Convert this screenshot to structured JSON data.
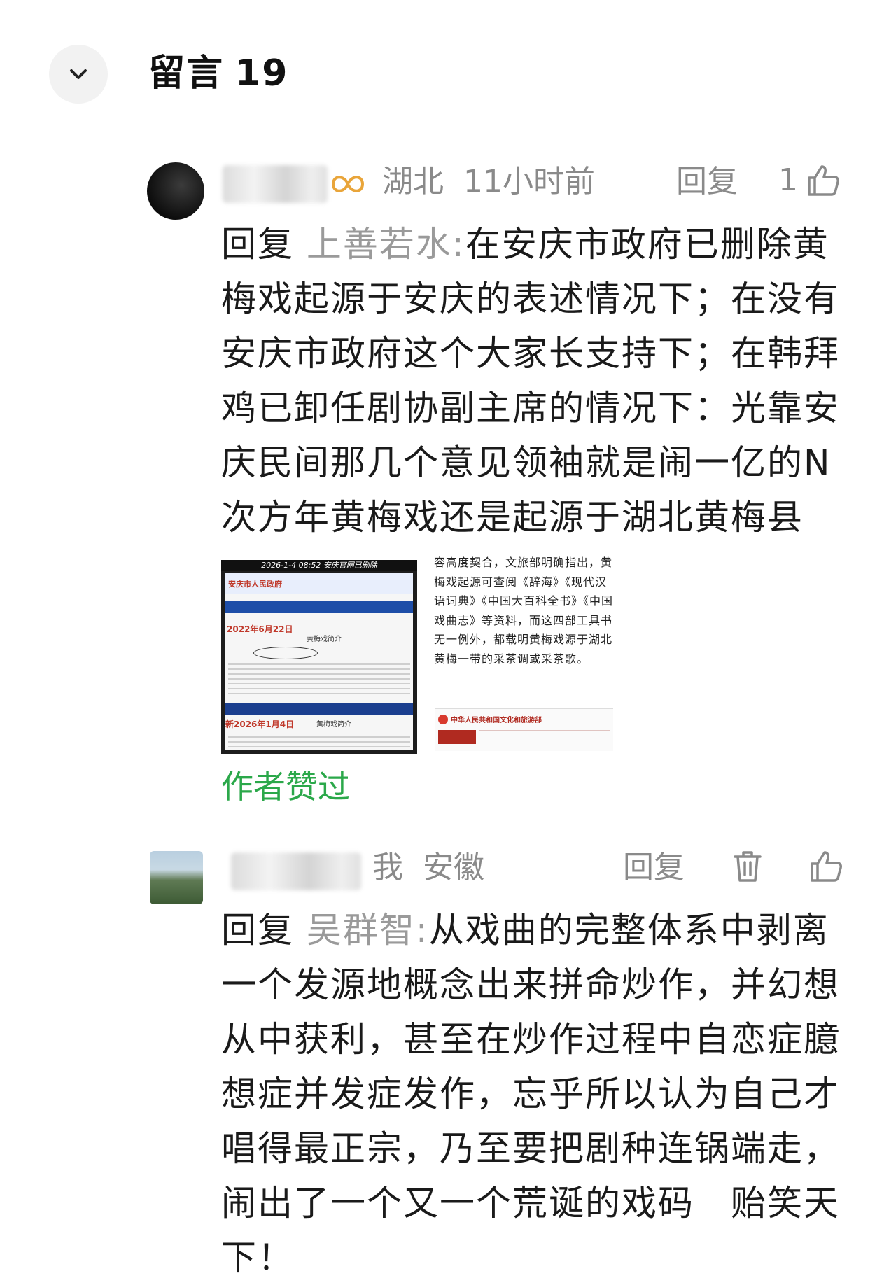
{
  "header": {
    "title": "留言",
    "count": "19"
  },
  "comments": [
    {
      "location": "湖北",
      "time": "11小时前",
      "reply_label": "回复",
      "like_count": "1",
      "prefix": "回复",
      "reply_to": "上善若水:",
      "text": "在安庆市政府已删除黄梅戏起源于安庆的表述情况下；在没有安庆市政府这个大家长支持下；在韩拜鸡已卸任剧协副主席的情况下：光靠安庆民间那几个意见领袖就是闹一亿的N次方年黄梅戏还是起源于湖北黄梅县",
      "image1": {
        "caption": "2026-1-4 08:52 安庆官网已删除",
        "site": "安庆市人民政府",
        "date_old": "2022年6月22日",
        "heading": "黄梅戏简介",
        "date_new": "新2026年1月4日"
      },
      "image2": {
        "text": "容高度契合，文旅部明确指出，黄梅戏起源可查阅《辞海》《现代汉语词典》《中国大百科全书》《中国戏曲志》等资料，而这四部工具书无一例外，都载明黄梅戏源于湖北黄梅一带的采茶调或采茶歌。",
        "site": "中华人民共和国文化和旅游部"
      },
      "author_liked": "作者赞过"
    },
    {
      "me": "我",
      "location": "安徽",
      "reply_label": "回复",
      "prefix": "回复",
      "reply_to": "吴群智:",
      "text": "从戏曲的完整体系中剥离一个发源地概念出来拼命炒作，并幻想从中获利，甚至在炒作过程中自恋症臆想症并发症发作，忘乎所以认为自己才唱得最正宗，乃至要把剧种连锅端走，闹出了一个又一个荒诞的戏码　贻笑天下！"
    }
  ],
  "icons": {
    "back": "chevron-down-icon",
    "like": "thumbs-up-icon",
    "delete": "trash-icon",
    "badge": "infinity-badge-icon"
  },
  "colors": {
    "author_liked": "#2ba84a",
    "muted": "#8a8a8a"
  }
}
